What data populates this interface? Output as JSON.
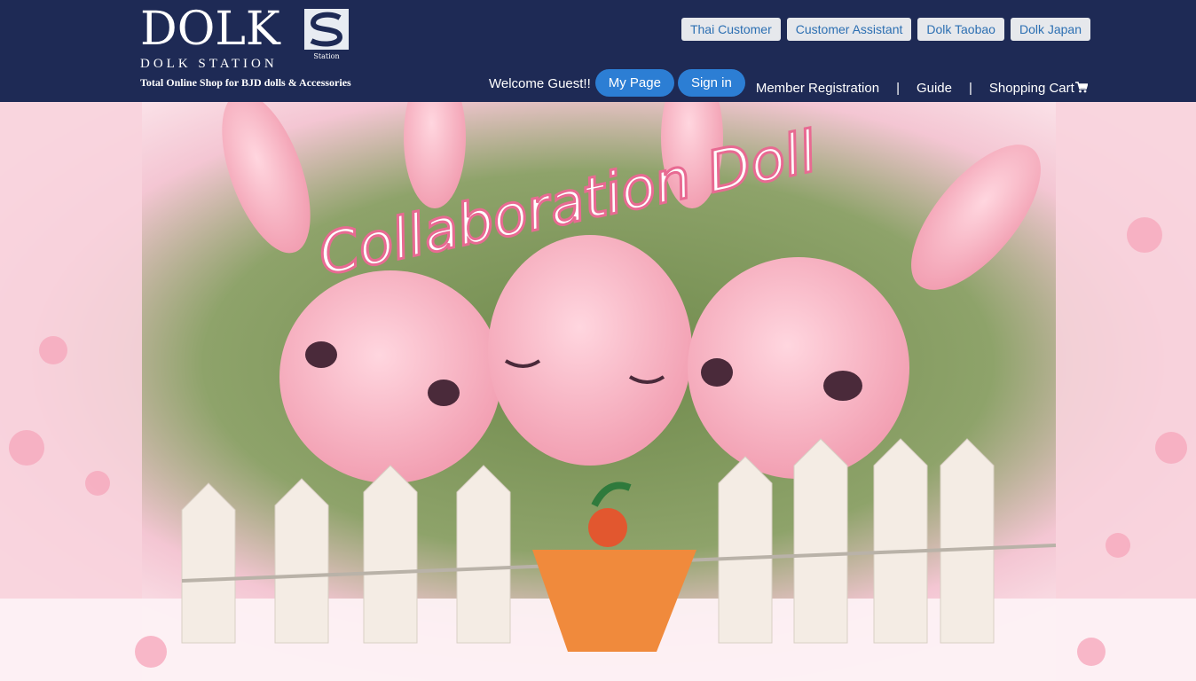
{
  "brand": {
    "logo_word": "DOLK",
    "logo_mark_text": "Station",
    "subtitle": "DOLK STATION",
    "tagline": "Total Online Shop for BJD dolls & Accessories"
  },
  "top_links": [
    "Thai Customer",
    "Customer Assistant",
    "Dolk Taobao",
    "Dolk Japan"
  ],
  "nav": {
    "welcome": "Welcome Guest!!",
    "my_page": "My Page",
    "sign_in": "Sign in",
    "member_registration": "Member Registration",
    "separator": "|",
    "guide": "Guide",
    "shopping_cart": "Shopping Cart",
    "cart_icon": "cart-icon"
  },
  "banner": {
    "title_text": "Collaboration Doll"
  },
  "colors": {
    "header_bg": "#1e2a55",
    "pill_blue": "#2c7ed4",
    "link_blue": "#2c6fb2",
    "banner_pink": "#f5b8c8"
  }
}
